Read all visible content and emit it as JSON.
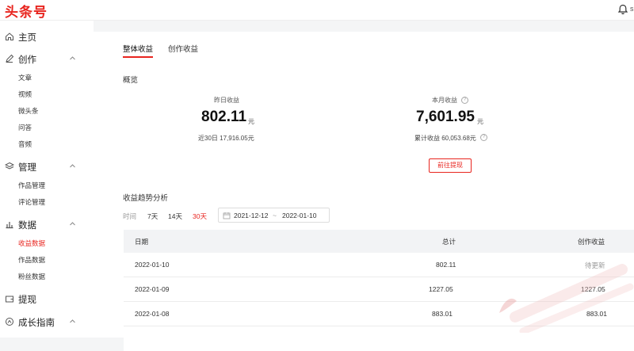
{
  "header": {
    "logo": "头条号",
    "user_initial": "s"
  },
  "sidebar": {
    "groups": [
      {
        "label": "主页",
        "icon": "home-icon",
        "items": []
      },
      {
        "label": "创作",
        "icon": "pen-icon",
        "items": [
          "文章",
          "视频",
          "微头条",
          "问答",
          "音频"
        ]
      },
      {
        "label": "管理",
        "icon": "layers-icon",
        "items": [
          "作品管理",
          "评论管理"
        ]
      },
      {
        "label": "数据",
        "icon": "bar-chart-icon",
        "items": [
          "收益数据",
          "作品数据",
          "粉丝数据"
        ],
        "active_item": "收益数据"
      },
      {
        "label": "提现",
        "icon": "wallet-icon",
        "items": []
      },
      {
        "label": "成长指南",
        "icon": "growth-icon",
        "items": []
      }
    ]
  },
  "tabs": [
    {
      "label": "整体收益",
      "active": true
    },
    {
      "label": "创作收益",
      "active": false
    }
  ],
  "overview": {
    "title": "概览",
    "yesterday": {
      "label": "昨日收益",
      "value": "802.11",
      "unit": "元",
      "sub": "近30日 17,916.05元"
    },
    "month": {
      "label": "本月收益",
      "value": "7,601.95",
      "unit": "元",
      "sub": "累计收益 60,053.68元",
      "help": "?"
    },
    "withdraw_label": "前往提现"
  },
  "trend": {
    "title": "收益趋势分析",
    "time_label": "时间",
    "options": [
      {
        "label": "7天"
      },
      {
        "label": "14天"
      },
      {
        "label": "30天",
        "active": true
      }
    ],
    "date_start": "2021-12-12",
    "date_sep": "~",
    "date_end": "2022-01-10"
  },
  "table": {
    "columns": [
      "日期",
      "总计",
      "创作收益"
    ],
    "rows": [
      {
        "date": "2022-01-10",
        "total": "802.11",
        "creation": "待更新"
      },
      {
        "date": "2022-01-09",
        "total": "1227.05",
        "creation": "1227.05"
      },
      {
        "date": "2022-01-08",
        "total": "883.01",
        "creation": "883.01"
      }
    ]
  },
  "colors": {
    "accent": "#e8251f",
    "header_bg": "#f2f3f5",
    "page_bg": "#f4f5f6"
  }
}
